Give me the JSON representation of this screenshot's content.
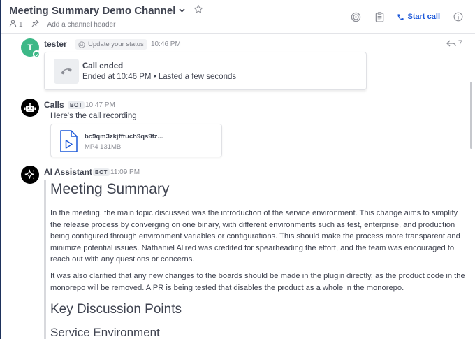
{
  "channel": {
    "name": "Meeting Summary Demo Channel",
    "member_count": "1",
    "header_placeholder": "Add a channel header",
    "start_call": "Start call"
  },
  "messages": [
    {
      "author": "tester",
      "avatar_letter": "T",
      "status_prompt": "Update your status",
      "time": "10:46 PM",
      "reply_count": "7",
      "call_card": {
        "title": "Call ended",
        "subtitle": "Ended at 10:46 PM • Lasted a few seconds"
      }
    },
    {
      "author": "Calls",
      "badge": "BOT",
      "time": "10:47 PM",
      "text": "Here's the call recording",
      "file": {
        "name": "bc9qm3zkjfftuch9qs9fz...",
        "meta": "MP4 131MB"
      }
    },
    {
      "author": "AI Assistant",
      "badge": "BOT",
      "time": "11:09 PM",
      "summary": {
        "heading": "Meeting Summary",
        "paragraphs": [
          "In the meeting, the main topic discussed was the introduction of the service environment. This change aims to simplify the release process by converging on one binary, with different environments such as test, enterprise, and production being configured through environment variables or configurations. This should make the process more transparent and minimize potential issues. Nathaniel Allred was credited for spearheading the effort, and the team was encouraged to reach out with any questions or concerns.",
          "It was also clarified that any new changes to the boards should be made in the plugin directly, as the product code in the monorepo will be removed. A PR is being tested that disables the product as a whole in the monorepo."
        ],
        "subheading": "Key Discussion Points",
        "section": "Service Environment"
      }
    }
  ],
  "colors": {
    "accent": "#1c58d9",
    "online": "#3db887",
    "text": "#3f4350",
    "muted": "#8b8d95"
  },
  "icons": [
    "chevron-down-icon",
    "star-icon",
    "member-icon",
    "pin-icon",
    "target-icon",
    "clipboard-icon",
    "phone-icon",
    "info-icon",
    "reply-arrow-icon",
    "smiley-icon",
    "bot-icon",
    "sparkle-icon",
    "video-file-icon"
  ]
}
